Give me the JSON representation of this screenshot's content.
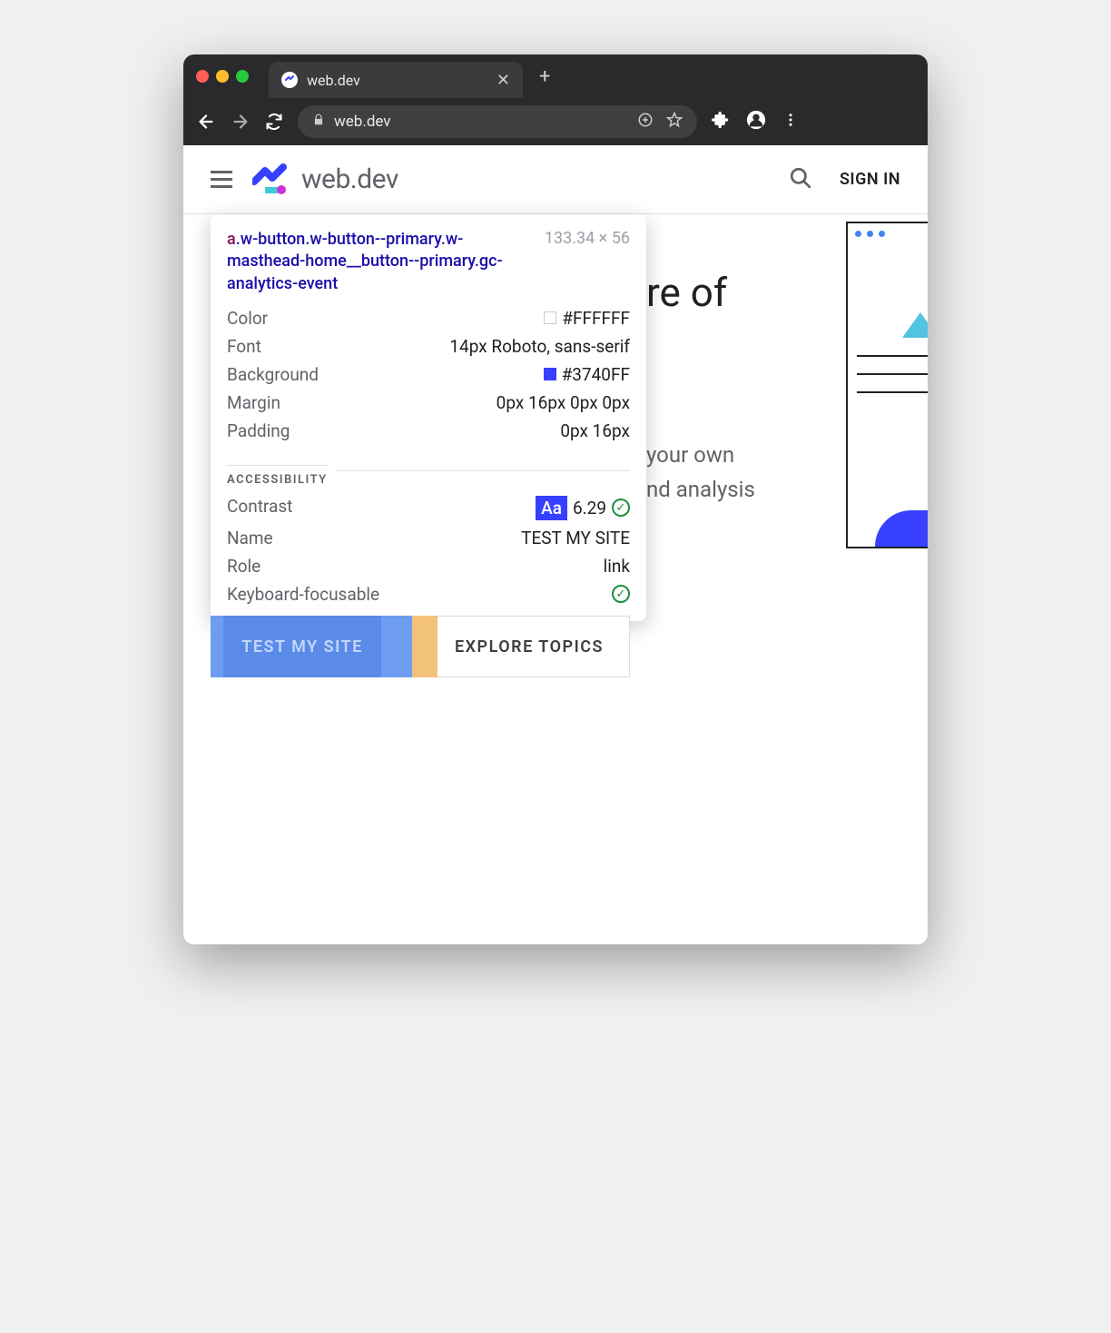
{
  "browser": {
    "tab_title": "web.dev",
    "url": "web.dev",
    "new_tab": "+"
  },
  "site": {
    "logo_text": "web.dev",
    "signin": "SIGN IN"
  },
  "hero": {
    "title_fragment": "re of",
    "sub_line1": "your own",
    "sub_line2": "nd analysis"
  },
  "buttons": {
    "primary": "TEST MY SITE",
    "secondary": "EXPLORE TOPICS"
  },
  "tooltip": {
    "tag": "a",
    "selector": ".w-button.w-button--primary.w-masthead-home__button--primary.gc-analytics-event",
    "dimensions": "133.34 × 56",
    "rows": {
      "color_label": "Color",
      "color_value": "#FFFFFF",
      "font_label": "Font",
      "font_value": "14px Roboto, sans-serif",
      "background_label": "Background",
      "background_value": "#3740FF",
      "margin_label": "Margin",
      "margin_value": "0px 16px 0px 0px",
      "padding_label": "Padding",
      "padding_value": "0px 16px"
    },
    "a11y_section": "ACCESSIBILITY",
    "a11y": {
      "contrast_label": "Contrast",
      "contrast_aa": "Aa",
      "contrast_value": "6.29",
      "name_label": "Name",
      "name_value": "TEST MY SITE",
      "role_label": "Role",
      "role_value": "link",
      "focusable_label": "Keyboard-focusable"
    }
  }
}
